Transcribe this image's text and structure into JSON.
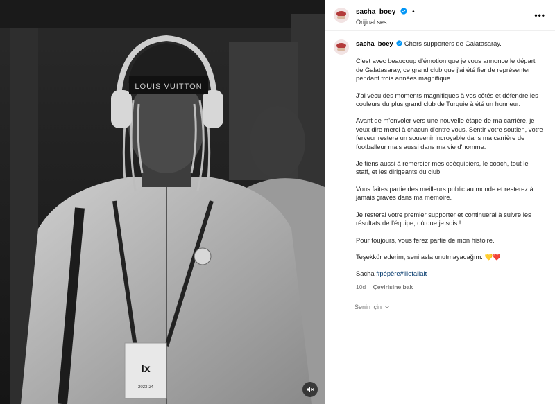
{
  "post": {
    "username": "sacha_boey",
    "dot": "•",
    "audio": "Orijinal ses",
    "more": "•••",
    "caption": [
      "Chers supporters de Galatasaray.",
      "C'est avec beaucoup d'émotion que je vous annonce le départ de Galatasaray, ce grand club que j'ai été fier de représenter pendant trois années magnifique.",
      "J'ai vécu des moments magnifiques à vos côtés et défendre les couleurs du plus grand club de Turquie à été un honneur.",
      "Avant de m'envoler vers une nouvelle étape de ma carrière, je veux dire merci à chacun d'entre vous. Sentir votre soutien, votre ferveur restera un souvenir incroyable dans ma carrière de footballeur mais aussi dans ma vie d'homme.",
      "Je tiens aussi à remercier mes coéquipiers, le coach, tout le staff, et les dirigeants du club",
      "Vous faites partie des meilleurs public au monde et resterez à jamais gravés dans ma mémoire.",
      "Je resterai votre premier supporter et continuerai à suivre les résultats de l'équipe, où que je sois !",
      "Pour toujours, vous ferez partie de mon histoire.",
      "Teşekkür ederim, seni asla unutmayacağım. 💛❤️"
    ],
    "signoff": "Sacha",
    "hashtags": "#pépère#illefallait",
    "age": "10d",
    "see_translation": "Çevirisine bak",
    "for_you": "Senin için"
  },
  "media": {
    "beanie_text": "LOUIS VUITTON",
    "badge_text": "Ix",
    "badge_year": "2023-24"
  }
}
